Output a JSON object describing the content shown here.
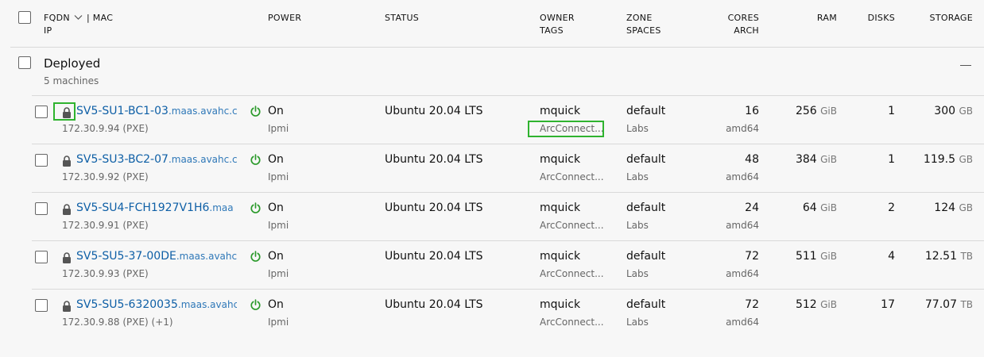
{
  "header": {
    "fqdn": "FQDN",
    "mac": "| MAC",
    "ip": "IP",
    "power": "POWER",
    "status": "STATUS",
    "owner": "OWNER",
    "tags": "TAGS",
    "zone": "ZONE",
    "spaces": "SPACES",
    "cores": "CORES",
    "arch": "ARCH",
    "ram": "RAM",
    "disks": "DISKS",
    "storage": "STORAGE"
  },
  "group": {
    "title": "Deployed",
    "count": "5 machines"
  },
  "machines": [
    {
      "host": "SV5-SU1-BC1-03",
      "domain": ".maas.avahc.c",
      "ip": "172.30.9.94 (PXE)",
      "power": "On",
      "power_type": "Ipmi",
      "status": "Ubuntu 20.04 LTS",
      "owner": "mquick",
      "tags": "ArcConnect...",
      "zone": "default",
      "space": "Labs",
      "cores": "16",
      "arch": "amd64",
      "ram": "256",
      "ram_unit": "GiB",
      "disks": "1",
      "storage": "300",
      "storage_unit": "GB"
    },
    {
      "host": "SV5-SU3-BC2-07",
      "domain": ".maas.avahc.c",
      "ip": "172.30.9.92 (PXE)",
      "power": "On",
      "power_type": "Ipmi",
      "status": "Ubuntu 20.04 LTS",
      "owner": "mquick",
      "tags": "ArcConnect...",
      "zone": "default",
      "space": "Labs",
      "cores": "48",
      "arch": "amd64",
      "ram": "384",
      "ram_unit": "GiB",
      "disks": "1",
      "storage": "119.5",
      "storage_unit": "GB"
    },
    {
      "host": "SV5-SU4-FCH1927V1H6",
      "domain": ".maa",
      "ip": "172.30.9.91 (PXE)",
      "power": "On",
      "power_type": "Ipmi",
      "status": "Ubuntu 20.04 LTS",
      "owner": "mquick",
      "tags": "ArcConnect...",
      "zone": "default",
      "space": "Labs",
      "cores": "24",
      "arch": "amd64",
      "ram": "64",
      "ram_unit": "GiB",
      "disks": "2",
      "storage": "124",
      "storage_unit": "GB"
    },
    {
      "host": "SV5-SU5-37-00DE",
      "domain": ".maas.avahc",
      "ip": "172.30.9.93 (PXE)",
      "power": "On",
      "power_type": "Ipmi",
      "status": "Ubuntu 20.04 LTS",
      "owner": "mquick",
      "tags": "ArcConnect...",
      "zone": "default",
      "space": "Labs",
      "cores": "72",
      "arch": "amd64",
      "ram": "511",
      "ram_unit": "GiB",
      "disks": "4",
      "storage": "12.51",
      "storage_unit": "TB"
    },
    {
      "host": "SV5-SU5-6320035",
      "domain": ".maas.avahc",
      "ip": "172.30.9.88 (PXE) (+1)",
      "power": "On",
      "power_type": "Ipmi",
      "status": "Ubuntu 20.04 LTS",
      "owner": "mquick",
      "tags": "ArcConnect...",
      "zone": "default",
      "space": "Labs",
      "cores": "72",
      "arch": "amd64",
      "ram": "512",
      "ram_unit": "GiB",
      "disks": "17",
      "storage": "77.07",
      "storage_unit": "TB"
    }
  ],
  "icons": {
    "lock": "lock-icon",
    "power": "power-icon",
    "sort": "chevron-down-icon",
    "collapse": "minus-icon"
  },
  "colors": {
    "link": "#0e5fa6",
    "power_on": "#2b9a2b",
    "highlight": "#2fb32f"
  }
}
